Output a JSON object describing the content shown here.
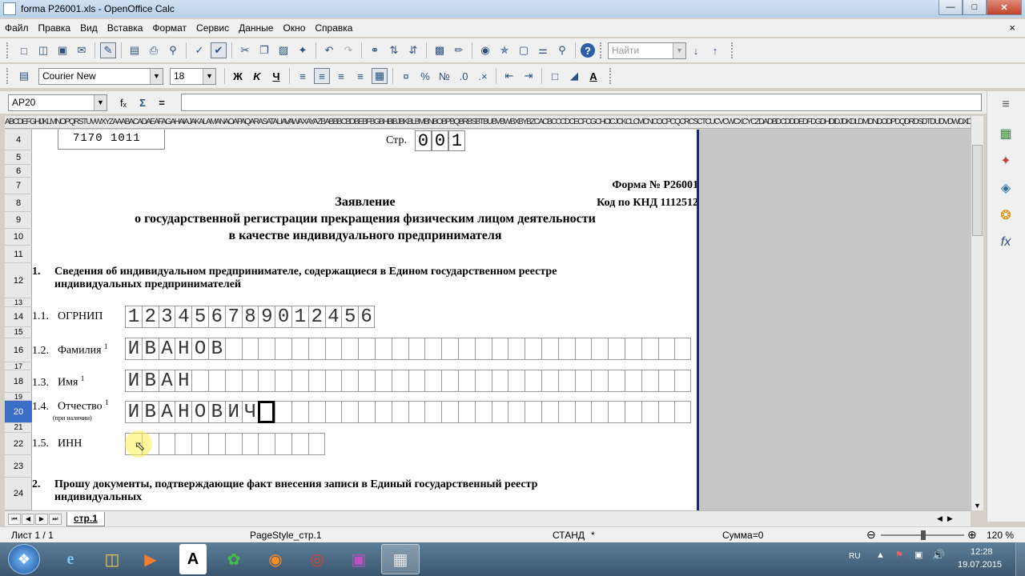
{
  "window": {
    "title": "forma P26001.xls - OpenOffice Calc",
    "min_label": "—",
    "max_label": "□",
    "close_label": "✕"
  },
  "menu": [
    "Файл",
    "Правка",
    "Вид",
    "Вставка",
    "Формат",
    "Сервис",
    "Данные",
    "Окно",
    "Справка"
  ],
  "menu_close": "×",
  "toolbar": {
    "find_placeholder": "Найти",
    "font_name": "Courier New",
    "font_size": "18",
    "bold": "Ж",
    "italic": "K",
    "underline": "Ч"
  },
  "formula_bar": {
    "cell_ref": "AP20",
    "formula": ""
  },
  "column_header_text": "ABCDEFGHIJKLMNOPQRSTUVWXYZAAABACADAEAFAGAHAIAJAKALAMANAOAPAQARASATAUAVAWAXAYAZBABBBCBDBEBFBGBHBIBJBKBLBMBNBOBPBQBRBSBTBUBVBWBXBYBZCACBCCCDCECFCGCHCICJCKCLCMCNCOCPCQCRCSCTCUCVCWCXCYCZDADBDCDDDEDFDGDHDIDJDKDLDMDNDODPDQDRDSDTDUDVDWDXDYDZEAEBECEDEEEFEGEHEIEJEKELEMENEOEPEQERESETEUEVEWEXEYEZFAFBFCFDFEFFFGFH",
  "rows": [
    "4",
    "5",
    "6",
    "7",
    "8",
    "9",
    "10",
    "11",
    "12",
    "13",
    "14",
    "15",
    "16",
    "17",
    "18",
    "19",
    "20",
    "21",
    "22",
    "23",
    "24"
  ],
  "active_row": "20",
  "form": {
    "barcode": "7170 1011",
    "page_label": "Стр.",
    "page_digits": [
      "0",
      "0",
      "1"
    ],
    "form_number": "Форма № Р&#26001",
    "knd": "Код по КНД 1112512",
    "title1": "Заявление",
    "title2": "о государственной регистрации прекращения физическим лицом деятельности",
    "title3": "в качестве индивидуального предпринимателя",
    "section1_num": "1.",
    "section1_line1": "Сведения об индивидуальном предпринимателе, содержащиеся в Едином государственном реестре",
    "section1_line2": "индивидуальных предпринимателей",
    "fields": [
      {
        "num": "1.1.",
        "label": "ОГРНИП",
        "sup": "",
        "chars": [
          "1",
          "2",
          "3",
          "4",
          "5",
          "6",
          "7",
          "8",
          "9",
          "0",
          "1",
          "2",
          "4",
          "5",
          "6"
        ],
        "total": 15
      },
      {
        "num": "1.2.",
        "label": "Фамилия",
        "sup": "1",
        "chars": [
          "И",
          "В",
          "А",
          "Н",
          "О",
          "В"
        ],
        "total": 34
      },
      {
        "num": "1.3.",
        "label": "Имя",
        "sup": "1",
        "chars": [
          "И",
          "В",
          "А",
          "Н"
        ],
        "total": 34
      },
      {
        "num": "1.4.",
        "label": "Отчество",
        "sup": "1",
        "chars": [
          "И",
          "В",
          "А",
          "Н",
          "О",
          "В",
          "И",
          "Ч"
        ],
        "total": 34,
        "cursor": 8
      },
      {
        "num": "1.5.",
        "label": "ИНН",
        "sup": "",
        "chars": [],
        "total": 12
      }
    ],
    "patronymic_note": "(при наличии)",
    "section2_num": "2.",
    "section2_line1": "Прошу документы, подтверждающие факт внесения записи в Единый государственный реестр",
    "section2_line2": "индивидуальных"
  },
  "sheet_tab": "стр.1",
  "status": {
    "sheet": "Лист 1 / 1",
    "page_style": "PageStyle_стр.1",
    "mode": "СТАНД",
    "modified": "*",
    "sum": "Сумма=0",
    "zoom": "120 %",
    "zoom_minus": "⊖",
    "zoom_plus": "⊕"
  },
  "taskbar": {
    "lang": "RU",
    "time": "12:28",
    "date": "19.07.2015"
  }
}
